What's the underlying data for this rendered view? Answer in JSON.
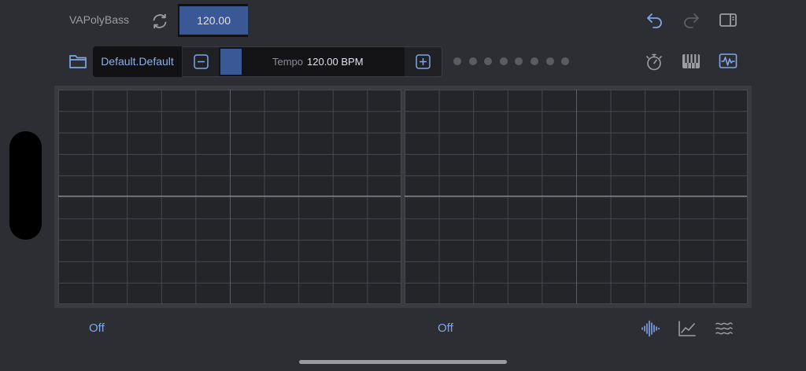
{
  "header": {
    "preset_title": "VAPolyBass",
    "top_value": "120.00"
  },
  "toolbar": {
    "preset_name": "Default.Default",
    "tempo_label": "Tempo",
    "tempo_value": "120.00 BPM",
    "page_dots": 8
  },
  "footer": {
    "left_status": "Off",
    "right_status": "Off"
  },
  "icons": {
    "refresh": "refresh-icon",
    "undo": "undo-icon",
    "redo": "redo-icon",
    "sidebar": "sidebar-panel-icon",
    "folder": "folder-icon",
    "minus": "minus-icon",
    "plus": "plus-icon",
    "metronome": "metronome-icon",
    "keyboard": "piano-keyboard-icon",
    "waveform_monitor": "waveform-monitor-icon",
    "waveform": "waveform-icon",
    "graph": "line-graph-icon",
    "wave_lines": "wave-lines-icon"
  },
  "colors": {
    "accent": "#7fa6e8",
    "fill": "#3b5896",
    "background": "#2d2e33"
  }
}
